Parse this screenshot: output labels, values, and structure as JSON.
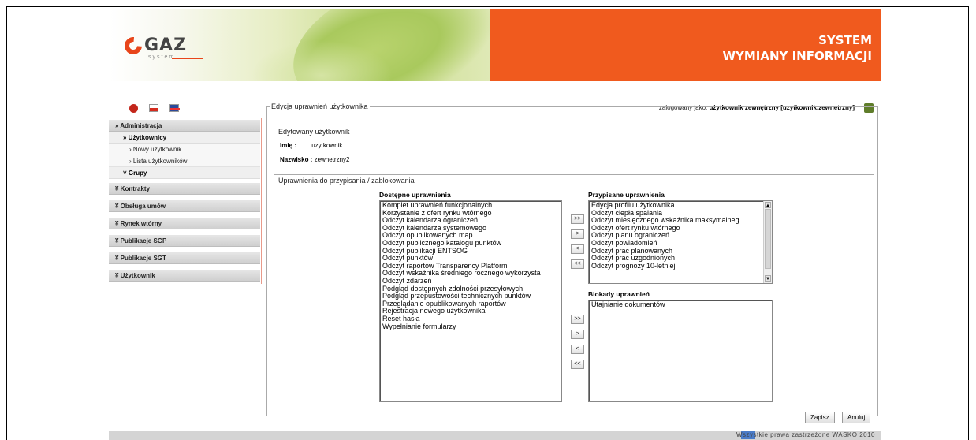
{
  "header": {
    "logo_text": "GAZ",
    "logo_sub": "system",
    "title_line1": "SYSTEM",
    "title_line2": "WYMIANY INFORMACJI"
  },
  "topbar": {
    "login_label": "zalogowany jako:",
    "login_user": "użytkownik zewnętrzny [uzytkownik.zewnetrzny]"
  },
  "sidebar": {
    "items": [
      {
        "label": "Administracja"
      },
      {
        "label": "Użytkownicy"
      },
      {
        "label": "Nowy użytkownik"
      },
      {
        "label": "Lista użytkowników"
      },
      {
        "label": "Grupy"
      },
      {
        "label": "Kontrakty"
      },
      {
        "label": "Obsługa umów"
      },
      {
        "label": "Rynek wtórny"
      },
      {
        "label": "Publikacje SGP"
      },
      {
        "label": "Publikacje SGT"
      },
      {
        "label": "Użytkownik"
      }
    ]
  },
  "form": {
    "legend": "Edycja uprawnień użytkownika",
    "user_legend": "Edytowany użytkownik",
    "imie_label": "Imię :",
    "imie_value": "uzytkownik",
    "nazwisko_label": "Nazwisko :",
    "nazwisko_value": "zewnetrzny2",
    "perm_legend": "Uprawnienia do przypisania / zablokowania",
    "available_label": "Dostępne uprawnienia",
    "assigned_label": "Przypisane uprawnienia",
    "blocked_label": "Blokady uprawnień",
    "available": [
      "Komplet uprawnień funkcjonalnych",
      "Korzystanie z ofert rynku wtórnego",
      "Odczyt kalendarza ograniczeń",
      "Odczyt kalendarza systemowego",
      "Odczyt opublikowanych map",
      "Odczyt publicznego katalogu punktów",
      "Odczyt publikacji ENTSOG",
      "Odczyt punktów",
      "Odczyt raportów Transparency Platform",
      "Odczyt wskaźnika średniego rocznego wykorzysta",
      "Odczyt zdarzeń",
      "Podgląd dostępnych zdolności przesyłowych",
      "Podgląd przepustowości technicznych punktów",
      "Przeglądanie opublikowanych raportów",
      "Rejestracja nowego użytkownika",
      "Reset hasła",
      "Wypełnianie formularzy"
    ],
    "assigned": [
      "Edycja profilu użytkownika",
      "Odczyt ciepła spalania",
      "Odczyt miesięcznego wskaźnika maksymalneg",
      "Odczyt ofert rynku wtórnego",
      "Odczyt planu ograniczeń",
      "Odczyt powiadomień",
      "Odczyt prac planowanych",
      "Odczyt prac uzgodnionych",
      "Odczyt prognozy 10-letniej"
    ],
    "blocked": [
      "Utajnianie dokumentów"
    ],
    "btn_all_right": ">>",
    "btn_right": ">",
    "btn_left": "<",
    "btn_all_left": "<<",
    "save": "Zapisz",
    "cancel": "Anuluj"
  },
  "footer": {
    "copyright": "Wszystkie prawa zastrzeżone WASKO 2010"
  }
}
